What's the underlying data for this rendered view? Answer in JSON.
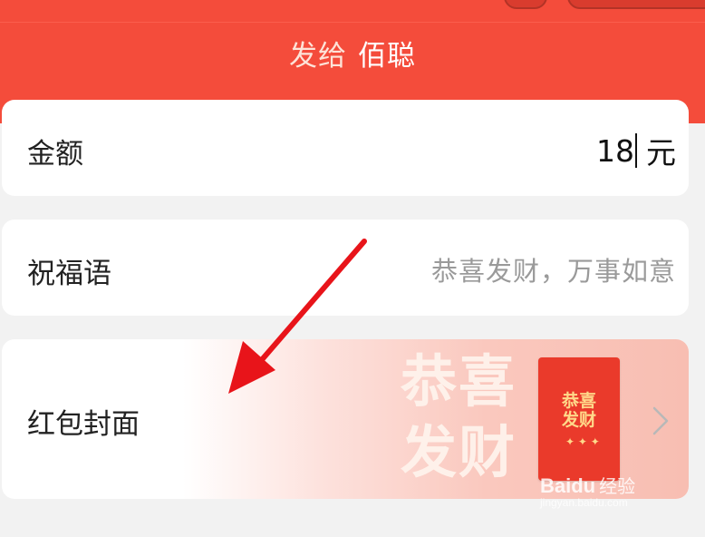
{
  "header": {
    "send_to_prefix": "发给",
    "recipient": "佰聪"
  },
  "amount": {
    "label": "金额",
    "value": "18",
    "unit": "元"
  },
  "greeting": {
    "label": "祝福语",
    "placeholder": "恭喜发财，万事如意"
  },
  "cover": {
    "label": "红包封面",
    "preview_text": "恭喜发财",
    "thumb_text": "恭喜发财"
  },
  "watermark": {
    "brand": "Baidu",
    "cn": "经验",
    "url": "jingyan.baidu.com"
  },
  "colors": {
    "header_red": "#f44c3b",
    "thumb_red": "#ea3a2b",
    "arrow_red": "#e8141a"
  },
  "icons": {
    "chevron": "chevron-right-icon"
  }
}
